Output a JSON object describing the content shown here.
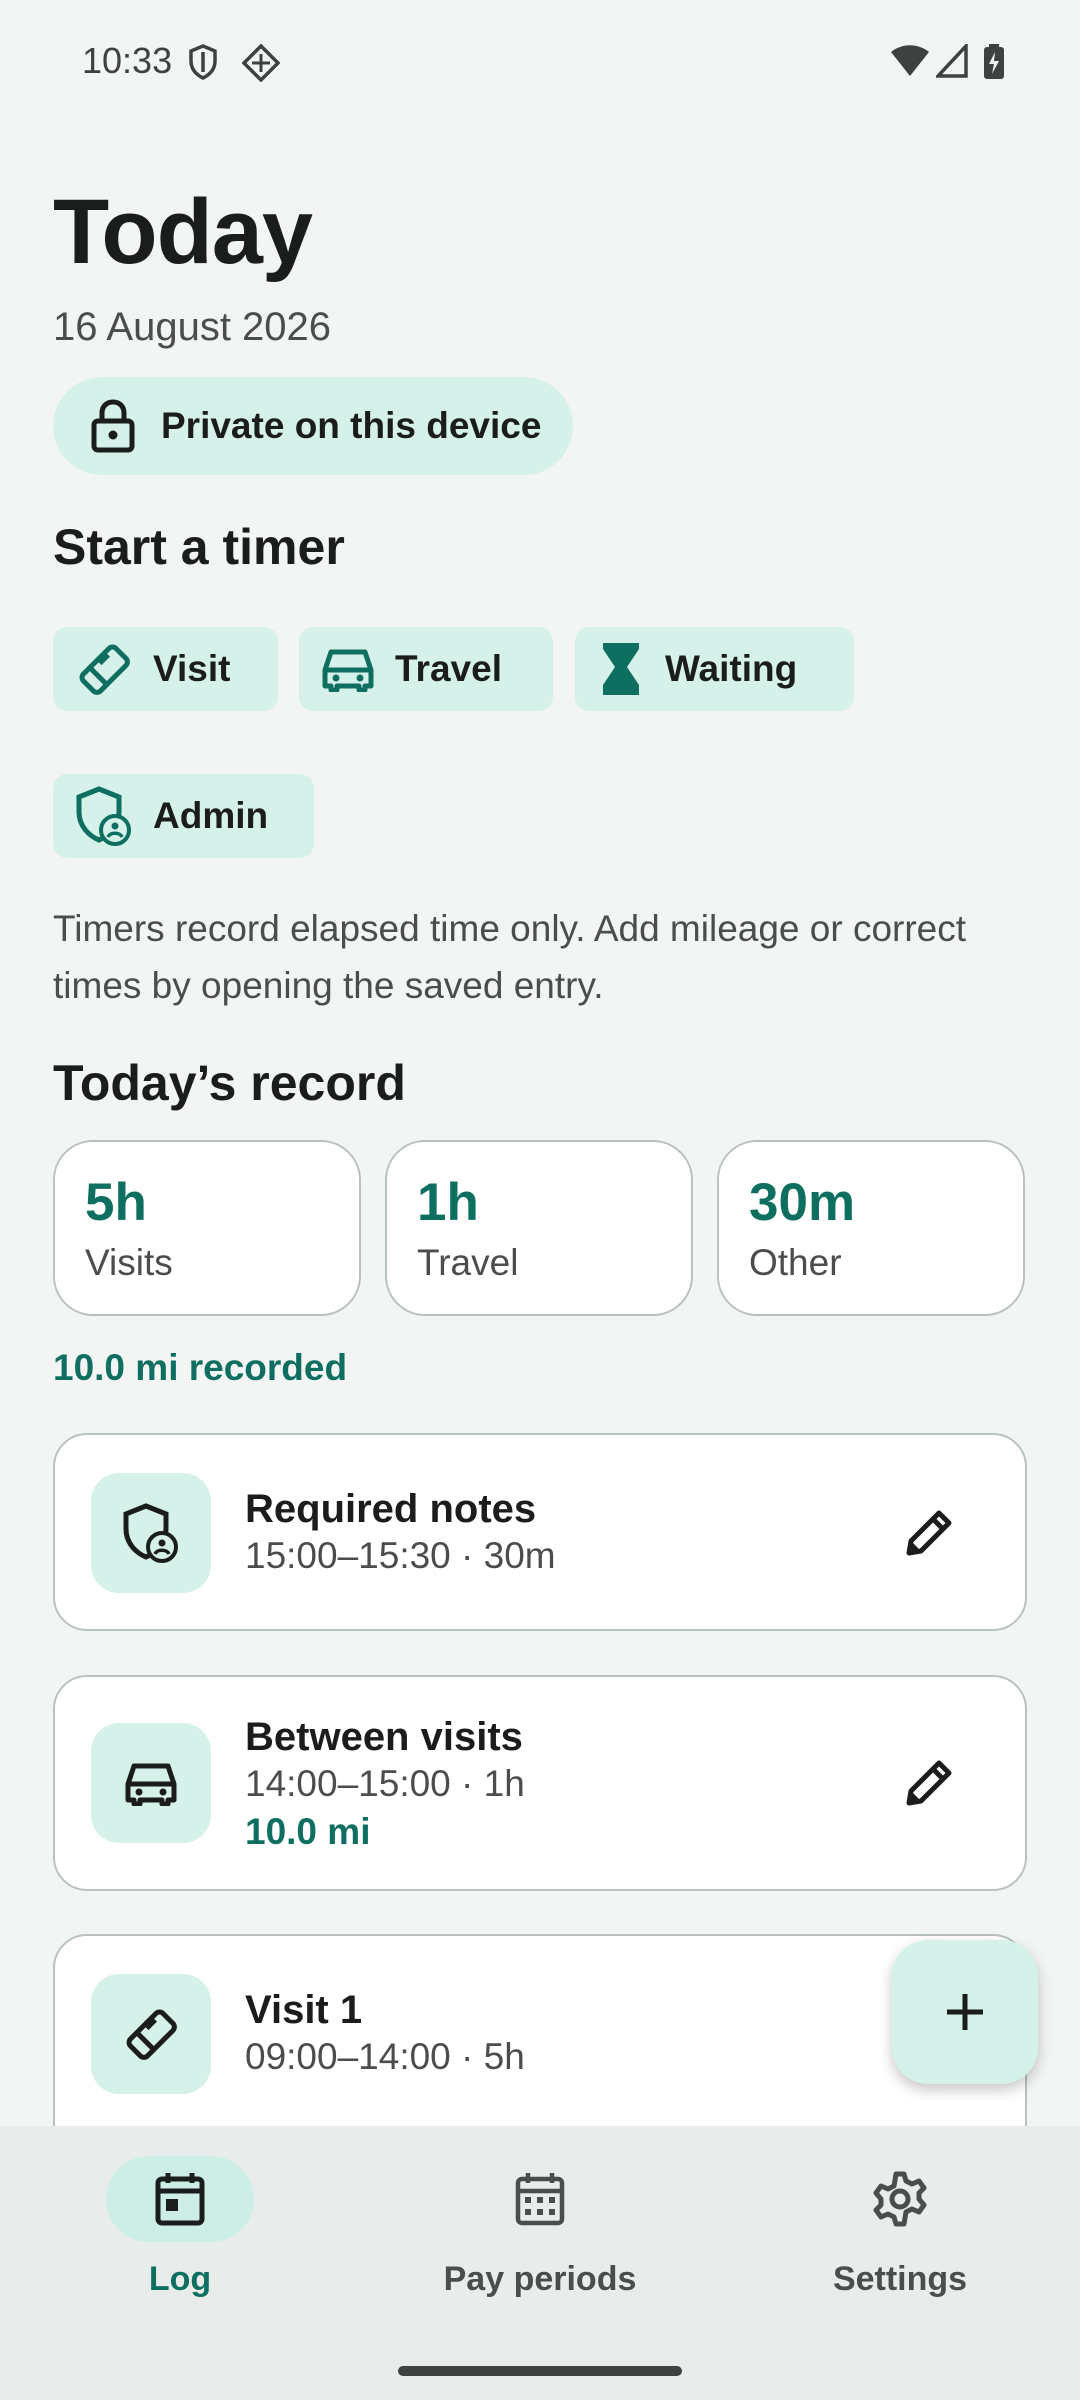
{
  "status": {
    "time": "10:33"
  },
  "header": {
    "title": "Today",
    "date": "16 August 2026",
    "privacy_chip": "Private on this device"
  },
  "timers": {
    "heading": "Start a timer",
    "buttons": [
      {
        "label": "Visit",
        "icon": "handshake-icon"
      },
      {
        "label": "Travel",
        "icon": "car-icon"
      },
      {
        "label": "Waiting",
        "icon": "hourglass-icon"
      },
      {
        "label": "Admin",
        "icon": "admin-shield-icon"
      }
    ],
    "note": "Timers record elapsed time only. Add mileage or correct times by opening the saved entry."
  },
  "record": {
    "heading": "Today’s record",
    "stats": [
      {
        "value": "5h",
        "label": "Visits"
      },
      {
        "value": "1h",
        "label": "Travel"
      },
      {
        "value": "30m",
        "label": "Other"
      }
    ],
    "miles": "10.0 mi recorded"
  },
  "entries": [
    {
      "title": "Required notes",
      "time": "15:00–15:30 · 30m",
      "icon": "admin-shield-icon"
    },
    {
      "title": "Between visits",
      "time": "14:00–15:00 · 1h",
      "miles": "10.0 mi",
      "icon": "car-icon"
    },
    {
      "title": "Visit 1",
      "time": "09:00–14:00 · 5h",
      "icon": "handshake-icon"
    }
  ],
  "nav": [
    {
      "label": "Log",
      "icon": "calendar-icon",
      "active": true
    },
    {
      "label": "Pay periods",
      "icon": "calendar-grid-icon",
      "active": false
    },
    {
      "label": "Settings",
      "icon": "gear-icon",
      "active": false
    }
  ],
  "colors": {
    "accent": "#0e6f61",
    "chip_bg": "#d5f1ea",
    "background": "#f3f5f4"
  }
}
